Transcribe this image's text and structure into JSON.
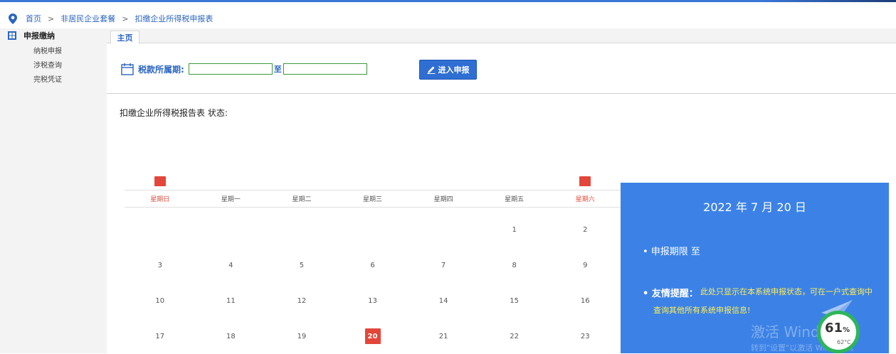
{
  "breadcrumb": {
    "items": [
      "首页",
      "非居民企业套餐",
      "扣缴企业所得税申报表"
    ],
    "separator": ">"
  },
  "sidebar": {
    "header": "申报缴纳",
    "items": [
      {
        "label": "纳税申报"
      },
      {
        "label": "涉税查询"
      },
      {
        "label": "完税凭证"
      }
    ]
  },
  "tabs": [
    {
      "label": "主页",
      "active": true
    }
  ],
  "period": {
    "label": "税款所属期:",
    "start_value": "",
    "to_label": "至",
    "end_value": ""
  },
  "enter_button": {
    "label": "进入申报"
  },
  "report_status": {
    "label": "扣缴企业所得税报告表 状态:"
  },
  "calendar": {
    "weekdays": [
      "星期日",
      "星期一",
      "星期二",
      "星期三",
      "星期四",
      "星期五",
      "星期六"
    ],
    "weeks": [
      [
        "",
        "",
        "",
        "",
        "",
        "1",
        "2"
      ],
      [
        "3",
        "4",
        "5",
        "6",
        "7",
        "8",
        "9"
      ],
      [
        "10",
        "11",
        "12",
        "13",
        "14",
        "15",
        "16"
      ],
      [
        "17",
        "18",
        "19",
        "20",
        "21",
        "22",
        "23"
      ]
    ],
    "today": "20"
  },
  "info_panel": {
    "date": "2022 年 7 月 20 日",
    "deadline": "• 申报期限  至",
    "reminder_title": "• 友情提醒：",
    "reminder_text": "此处只显示在本系统申报状态，可在一户式查询中查询其他所有系统申报信息!"
  },
  "overlay": {
    "watermark_title": "激活 Windows",
    "watermark_sub": "转到\"设置\"以激活 Windows。",
    "gauge_percent": "61",
    "gauge_unit": "%",
    "gauge_temp": "62°C"
  },
  "colors": {
    "accent": "#2b65c0",
    "panel": "#3c82e6",
    "today": "#e3463a",
    "reminder": "#ffee55"
  }
}
